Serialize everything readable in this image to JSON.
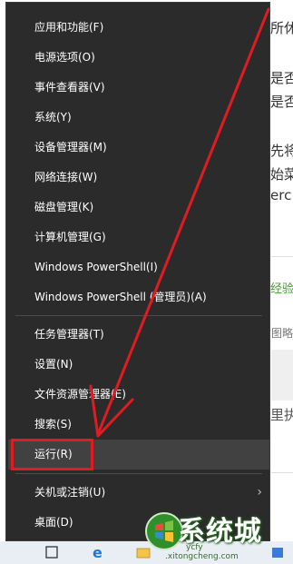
{
  "background": {
    "text_lines": [
      "所休眠",
      "是否",
      "是否",
      "先将",
      "始菜",
      "erc"
    ],
    "green_heading": "经验",
    "small_text": "图略",
    "bottom_text": "里执"
  },
  "menu": {
    "group1": [
      "应用和功能(F)",
      "电源选项(O)",
      "事件查看器(V)",
      "系统(Y)",
      "设备管理器(M)",
      "网络连接(W)",
      "磁盘管理(K)",
      "计算机管理(G)",
      "Windows PowerShell(I)",
      "Windows PowerShell (管理员)(A)"
    ],
    "group2": [
      "任务管理器(T)",
      "设置(N)",
      "文件资源管理器(E)",
      "搜索(S)",
      "运行(R)"
    ],
    "group3": [
      "关机或注销(U)",
      "桌面(D)"
    ],
    "submenu_arrow": "›",
    "highlighted_item": "运行(R)"
  },
  "annotation": {
    "box_color": "#e01b22",
    "arrow_color": "#e01b22"
  },
  "taskbar": {
    "icons": [
      "search-icon",
      "edge-icon",
      "file-explorer-icon",
      "app-icon"
    ],
    "labels": [
      "ycfy",
      ".xitongcheng.com"
    ]
  },
  "watermark": {
    "text": "系统城"
  }
}
